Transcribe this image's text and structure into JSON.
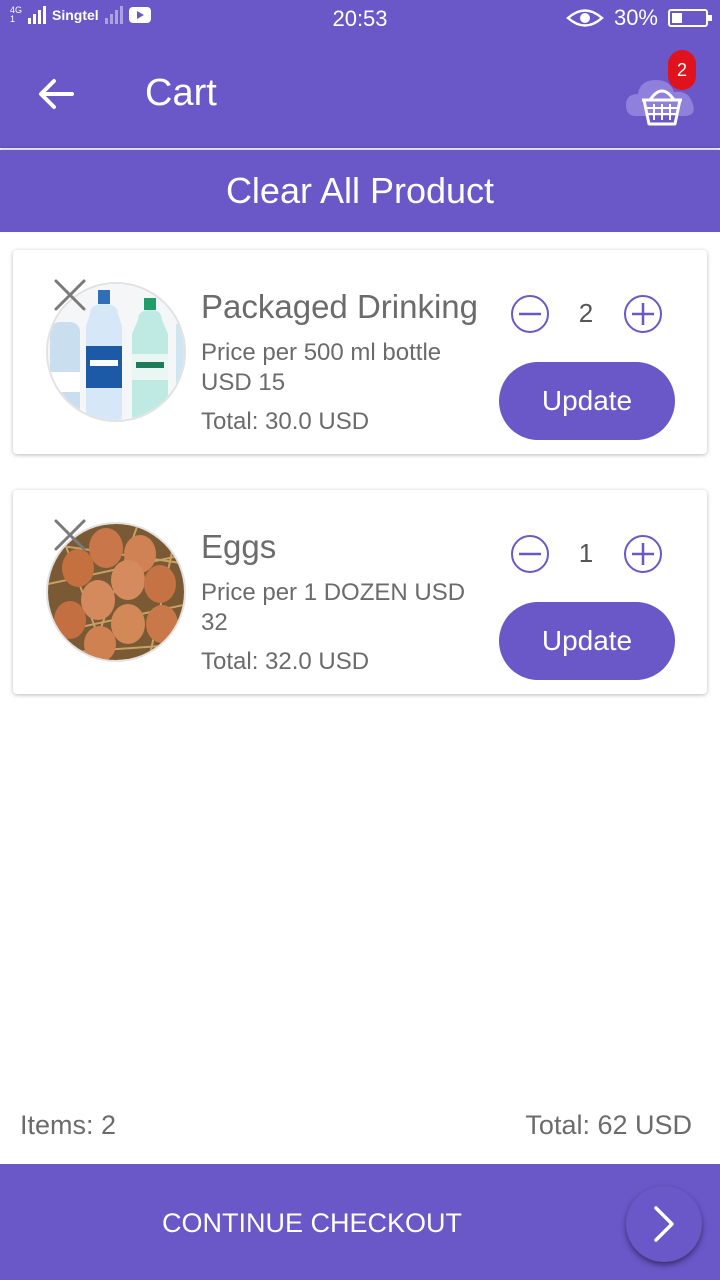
{
  "status_bar": {
    "network": "4G",
    "network_sub": "1",
    "carrier": "Singtel",
    "time": "20:53",
    "battery": "30%"
  },
  "app_bar": {
    "title": "Cart",
    "back_icon": "arrow-left-icon",
    "cart_icon": "basket-icon",
    "cart_badge": "2"
  },
  "clear_all_label": "Clear All Product",
  "cart_items": [
    {
      "name": "Packaged Drinking",
      "price_text": "Price per 500 ml bottle USD  15",
      "total_text": "Total: 30.0 USD",
      "quantity": "2",
      "update_label": "Update",
      "image": "water-bottles"
    },
    {
      "name": "Eggs",
      "price_text": "Price per 1 DOZEN USD 32",
      "total_text": "Total: 32.0 USD",
      "quantity": "1",
      "update_label": "Update",
      "image": "eggs-in-nest"
    }
  ],
  "summary": {
    "items_text": "Items: 2",
    "total_text": "Total: 62 USD"
  },
  "checkout": {
    "label": "CONTINUE CHECKOUT",
    "arrow_icon": "chevron-right-icon"
  },
  "colors": {
    "primary": "#6a57c8",
    "badge": "#e0121b",
    "text_gray": "#6b6b6b"
  }
}
